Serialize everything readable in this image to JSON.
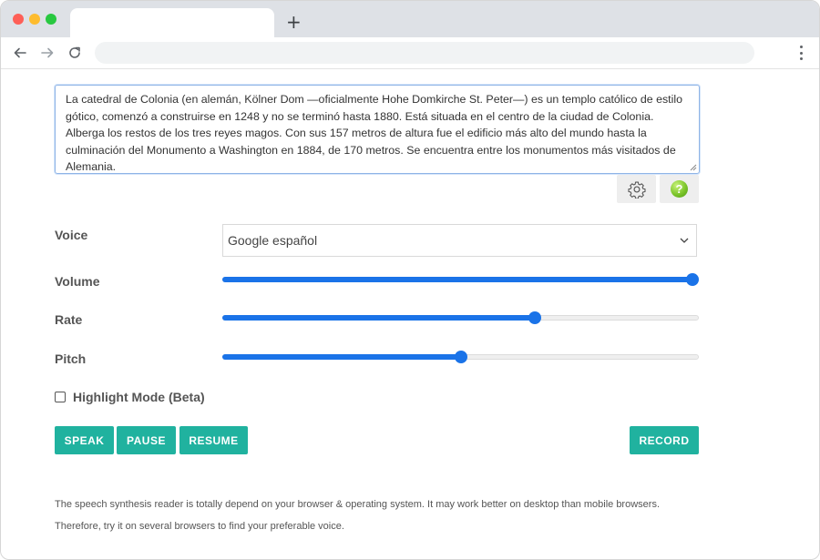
{
  "browser": {
    "new_tab_label": "+"
  },
  "editor": {
    "text": "La catedral de Colonia (en alemán, Kölner Dom —oficialmente Hohe Domkirche St. Peter—) es un templo católico de estilo gótico, comenzó a construirse en 1248 y no se terminó hasta 1880. Está situada en el centro de la ciudad de Colonia. Alberga los restos de los tres reyes magos. Con sus 157 metros de altura fue el edificio más alto del mundo hasta la culminación del Monumento a Washington en 1884, de 170 metros. Se encuentra entre los monumentos más visitados de Alemania.",
    "settings_icon": "gear-icon",
    "help_icon": "help-icon",
    "help_glyph": "?"
  },
  "controls": {
    "voice_label": "Voice",
    "voice_value": "Google español",
    "volume_label": "Volume",
    "volume_value": 1.0,
    "rate_label": "Rate",
    "rate_value": 0.66,
    "pitch_label": "Pitch",
    "pitch_value": 0.5,
    "highlight_label": "Highlight Mode (Beta)",
    "highlight_checked": false
  },
  "buttons": {
    "speak": "SPEAK",
    "pause": "PAUSE",
    "resume": "RESUME",
    "record": "RECORD"
  },
  "notes": {
    "line1": "The speech synthesis reader is totally depend on your browser & operating system. It may work better on desktop than mobile browsers.",
    "line2": "Therefore, try it on several browsers to find your preferable voice."
  },
  "colors": {
    "accent_button": "#20b29f",
    "slider": "#1a73e8"
  }
}
